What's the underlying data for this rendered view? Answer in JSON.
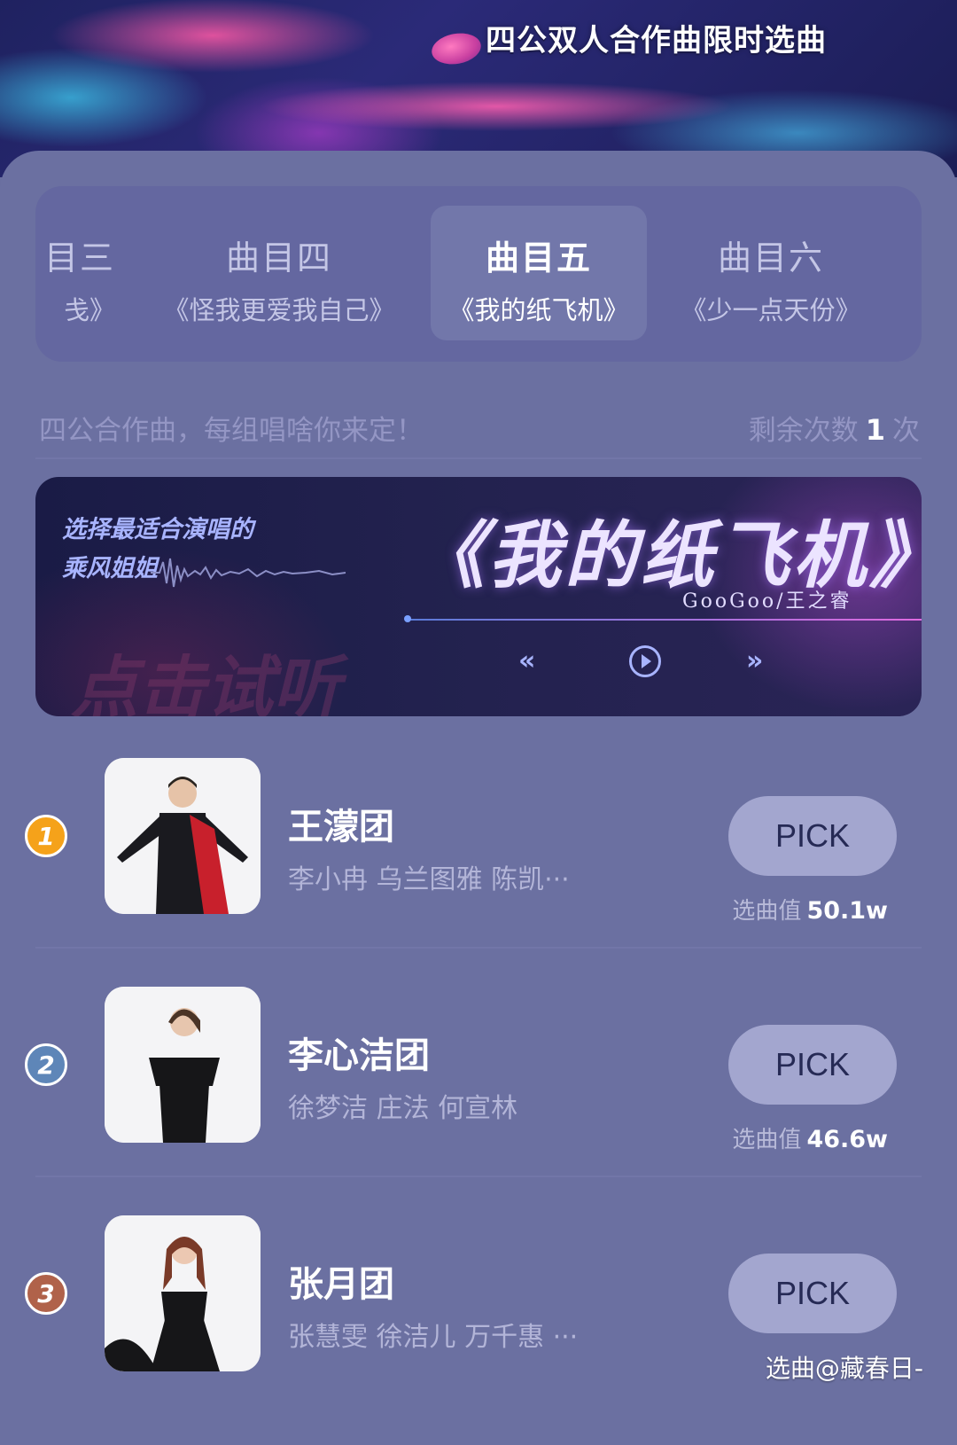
{
  "banner": {
    "title": "四公双人合作曲限时选曲"
  },
  "tabs": [
    {
      "title": "目三",
      "song": "戋》"
    },
    {
      "title": "曲目四",
      "song": "《怪我更爱我自己》"
    },
    {
      "title": "曲目五",
      "song": "《我的纸飞机》",
      "active": true
    },
    {
      "title": "曲目六",
      "song": "《少一点天份》"
    }
  ],
  "info": {
    "tagline": "四公合作曲，每组唱啥你来定！",
    "remaining_prefix": "剩余次数",
    "remaining_count": "1",
    "remaining_suffix": "次"
  },
  "player": {
    "subtitle_line1": "选择最适合演唱的",
    "subtitle_line2": "乘风姐姐",
    "watermark": "点击试听",
    "song_title": "《我的纸飞机》",
    "artist": "GooGoo/王之睿",
    "prev_icon": "double-chevron-left-icon",
    "play_icon": "play-circle-icon",
    "next_icon": "double-chevron-right-icon"
  },
  "groups": [
    {
      "rank": "1",
      "rank_color": "#f5a21a",
      "name": "王濛团",
      "members": "李小冉 乌兰图雅 陈凯···",
      "pick": "PICK",
      "score_label": "选曲值",
      "score": "50.1w"
    },
    {
      "rank": "2",
      "rank_color": "#5e86b8",
      "name": "李心洁团",
      "members": "徐梦洁 庄法 何宣林",
      "pick": "PICK",
      "score_label": "选曲值",
      "score": "46.6w"
    },
    {
      "rank": "3",
      "rank_color": "#b0624a",
      "name": "张月团",
      "members": "张慧雯 徐洁儿 万千惠 ···",
      "pick": "PICK"
    }
  ],
  "corner_watermark": "选曲@藏春日-"
}
